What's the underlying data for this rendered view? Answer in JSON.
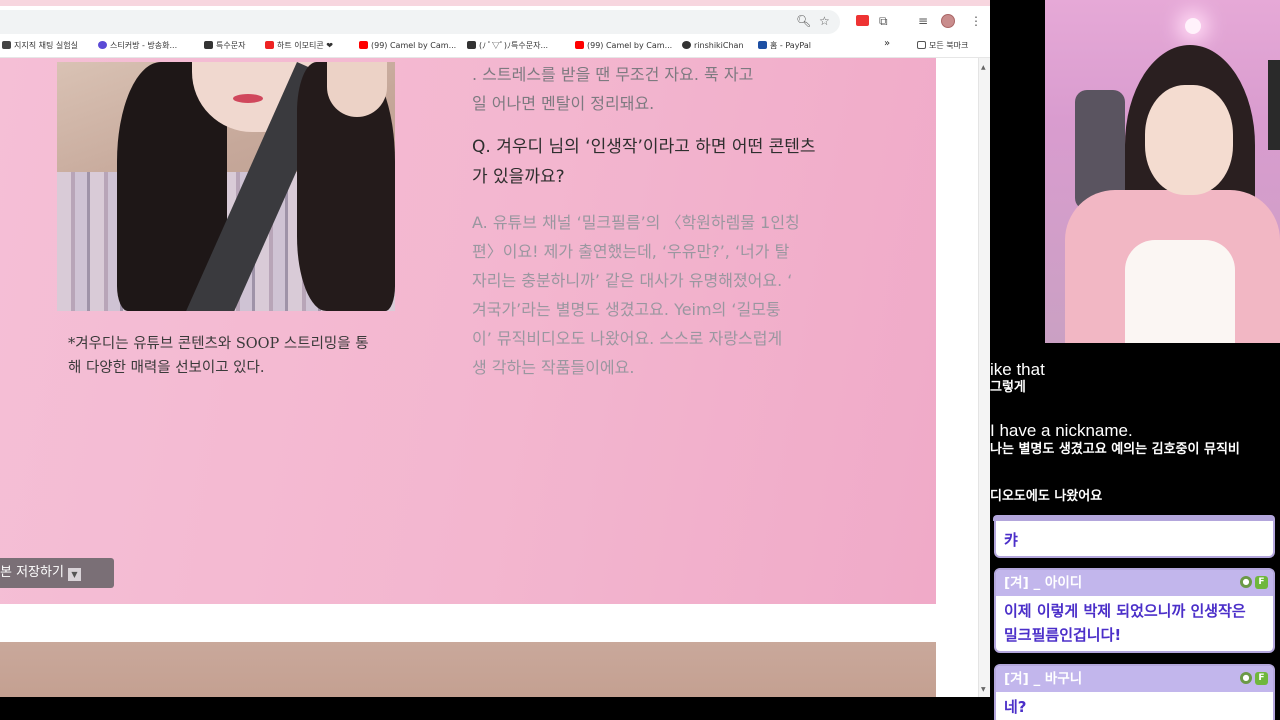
{
  "browser": {
    "bookmarks": [
      {
        "label": "지지직 채팅 실험실",
        "color": "#444444"
      },
      {
        "label": "스티커방 - 방송화...",
        "color": "#5b4ad6"
      },
      {
        "label": "특수문자",
        "color": "#333333"
      },
      {
        "label": "하트 이모티콘 ❤",
        "color": "#e22222"
      },
      {
        "label": "(99) Camel by Cam...",
        "color": "#ff0000"
      },
      {
        "label": "(ﾉ ﾟ▽ﾟ)ﾉ특수문자...",
        "color": "#333333"
      },
      {
        "label": "(99) Camel by Cam...",
        "color": "#ff0000"
      },
      {
        "label": "rinshikiChan",
        "color": "#333333"
      },
      {
        "label": "홈 - PayPal",
        "color": "#1d4fa3"
      }
    ],
    "bookmarks_more": "»",
    "all_bookmarks": "모든 북마크",
    "icons": {
      "zoom": "zoom-icon",
      "star": "star-icon",
      "extensions": "puzzle-icon",
      "menu": "more-vert-icon"
    }
  },
  "article": {
    "prev_lines": [
      ". 스트레스를 받을 땐 무조건 자요. 푹 자고",
      "일 어나면 멘탈이 정리돼요."
    ],
    "question_lines": [
      "Q. 겨우디 님의 ‘인생작’이라고 하면 어떤 콘텐츠",
      "가 있을까요?"
    ],
    "answer_lines": [
      "A. 유튜브 채널 ‘밀크필름’의 〈학원하렘물 1인칭",
      "편〉이요! 제가 출연했는데, ‘우유만?’, ‘너가 탈",
      "자리는 충분하니까’ 같은 대사가 유명해졌어요. ‘",
      "겨국가’라는 별명도 생겼고요. Yeim의 ‘길모퉁",
      "이’ 뮤직비디오도 나왔어요. 스스로 자랑스럽게",
      "생 각하는 작품들이에요."
    ],
    "caption_lines": [
      "*겨우디는 유튜브 콘텐츠와 SOOP 스트리밍을 통",
      "해 다양한 매력을 선보이고 있다."
    ],
    "save_button": "본 저장하기",
    "save_dropdown": "▼"
  },
  "subtitles": {
    "en_1": "ike that",
    "ko_1": "그렇게",
    "en_2": "I have a nickname.",
    "ko_2": "나는 별명도 생겼고요 예의는 김호중이 뮤직비",
    "ko_3": "디오도에도 나왔어요"
  },
  "chat": {
    "messages": [
      {
        "user": "",
        "text": [
          "캬"
        ],
        "partial": true
      },
      {
        "user": "[겨] _ 아이디",
        "text": [
          "이제 이렇게 박제 되었으니까 인생작은",
          "밀크필름인겁니다!"
        ]
      },
      {
        "user": "[겨] _ 바구니",
        "text": [
          "네?"
        ]
      }
    ],
    "badge_fan": "F",
    "accent": "#b3a6dc",
    "text_color": "#4b2fc9"
  }
}
